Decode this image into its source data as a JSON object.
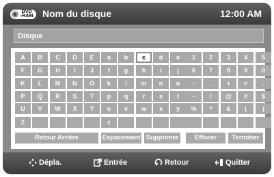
{
  "header": {
    "disc_badge_line1": "DVD",
    "disc_badge_line2": "-RAM",
    "title": "Nom du disque",
    "time": "12:00 AM"
  },
  "name_field": {
    "value": "Disque"
  },
  "keyboard": {
    "selected_key": "c",
    "rows": [
      [
        "A",
        "B",
        "C",
        "D",
        "E",
        "a",
        "b",
        "c",
        "d",
        "e",
        "1",
        "2",
        "3",
        "4",
        "5"
      ],
      [
        "F",
        "G",
        "H",
        "I",
        "J",
        "f",
        "g",
        "h",
        "i",
        "j",
        "6",
        "7",
        "8",
        "9",
        "0"
      ],
      [
        "K",
        "L",
        "M",
        "N",
        "O",
        "k",
        "l",
        "m",
        "n",
        "o",
        "-",
        "_",
        "+",
        "=",
        "."
      ],
      [
        "P",
        "Q",
        "R",
        "S",
        "T",
        "p",
        "q",
        "r",
        "s",
        "t",
        "~",
        "!",
        "@",
        "#",
        "$"
      ],
      [
        "U",
        "V",
        "W",
        "X",
        "Y",
        "u",
        "v",
        "w",
        "x",
        "y",
        "%",
        "^",
        "&",
        "(",
        ")"
      ],
      [
        "Z",
        "",
        "",
        "",
        "",
        "z",
        "",
        "",
        "",
        "",
        "",
        "",
        "",
        "",
        ""
      ]
    ]
  },
  "function_buttons": {
    "backspace": "Retour Arrière",
    "space": "Espacement",
    "delete": "Supprimer",
    "clear": "Effacer",
    "finish": "Terminer"
  },
  "footer": {
    "move": "Dépla.",
    "enter": "Entrée",
    "return": "Retour",
    "exit": "Quitter"
  },
  "colors": {
    "panel": "#8a8a8a",
    "bar": "#4a4a4a",
    "key": "#a9a9a9",
    "selected_key": "#ffffff"
  },
  "icons": {
    "disc": "dvd-ram-disc-icon",
    "move": "four-arrow-icon",
    "enter": "enter-icon",
    "return": "return-arrow-icon",
    "exit": "exit-icon"
  }
}
